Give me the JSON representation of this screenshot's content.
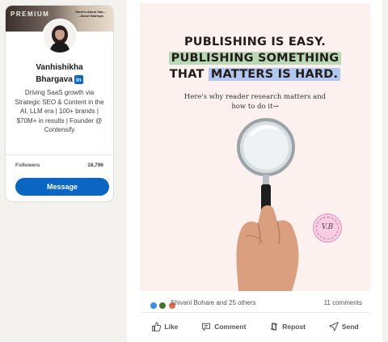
{
  "profile": {
    "badge": "PREMIUM",
    "banner_note": "Stories About Saa... ...About Startups",
    "name_line1": "Vanhishikha",
    "name_line2": "Bhargava",
    "linkedin_badge": "in",
    "headline": "Driving SaaS growth via Strategic SEO & Content in the AI, LLM era | 100+ brands | $70M+ in results | Founder @ Contensify",
    "followers_label": "Followers",
    "followers_count": "18,796",
    "message_label": "Message"
  },
  "post": {
    "headline_line1": "PUBLISHING IS EASY.",
    "headline_line2": "PUBLISHING SOMETHING",
    "headline_line3a": "THAT ",
    "headline_line3b": "MATTERS IS HARD.",
    "subtext": "Here's why reader research matters and how to do it→",
    "stamp_text": "V.B",
    "reactors": "Shivani Bohare and 25 others",
    "comments": "11 comments",
    "actions": {
      "like": "Like",
      "comment": "Comment",
      "repost": "Repost",
      "send": "Send"
    }
  },
  "colors": {
    "linkedin_blue": "#0a66c2",
    "post_bg": "#fcf1ee",
    "highlight_green": "#b9d8b5",
    "highlight_blue": "#b2c7ef"
  }
}
